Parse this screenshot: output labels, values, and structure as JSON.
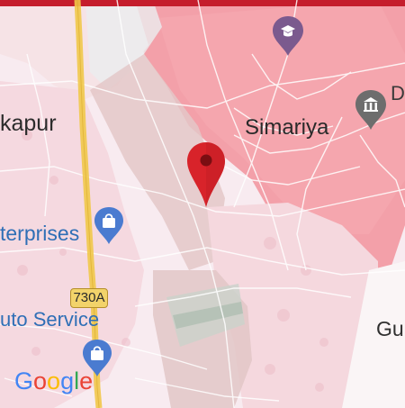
{
  "map": {
    "places": {
      "kapur": "kapur",
      "simariya": "Simariya",
      "d_partial": "D",
      "enterprises": "terprises",
      "auto_service": "uto Service",
      "gu_partial": "Gu"
    },
    "route_shield": "730A",
    "attribution": {
      "letters": [
        "G",
        "o",
        "o",
        "g",
        "l",
        "e"
      ],
      "colors": [
        "#4285F4",
        "#EA4335",
        "#FBBC05",
        "#4285F4",
        "#34A853",
        "#EA4335"
      ]
    }
  },
  "colors": {
    "highway": "#f1c84a",
    "pin_red": "#d8232a",
    "poi_purple": "#7b5a8e",
    "poi_gray": "#6d6d6d",
    "shop_blue": "#4a7bd0"
  },
  "icons": {
    "location_pin": "map-pin-icon",
    "school": "graduation-cap-icon",
    "museum": "landmark-icon",
    "shopping": "shopping-bag-icon"
  }
}
